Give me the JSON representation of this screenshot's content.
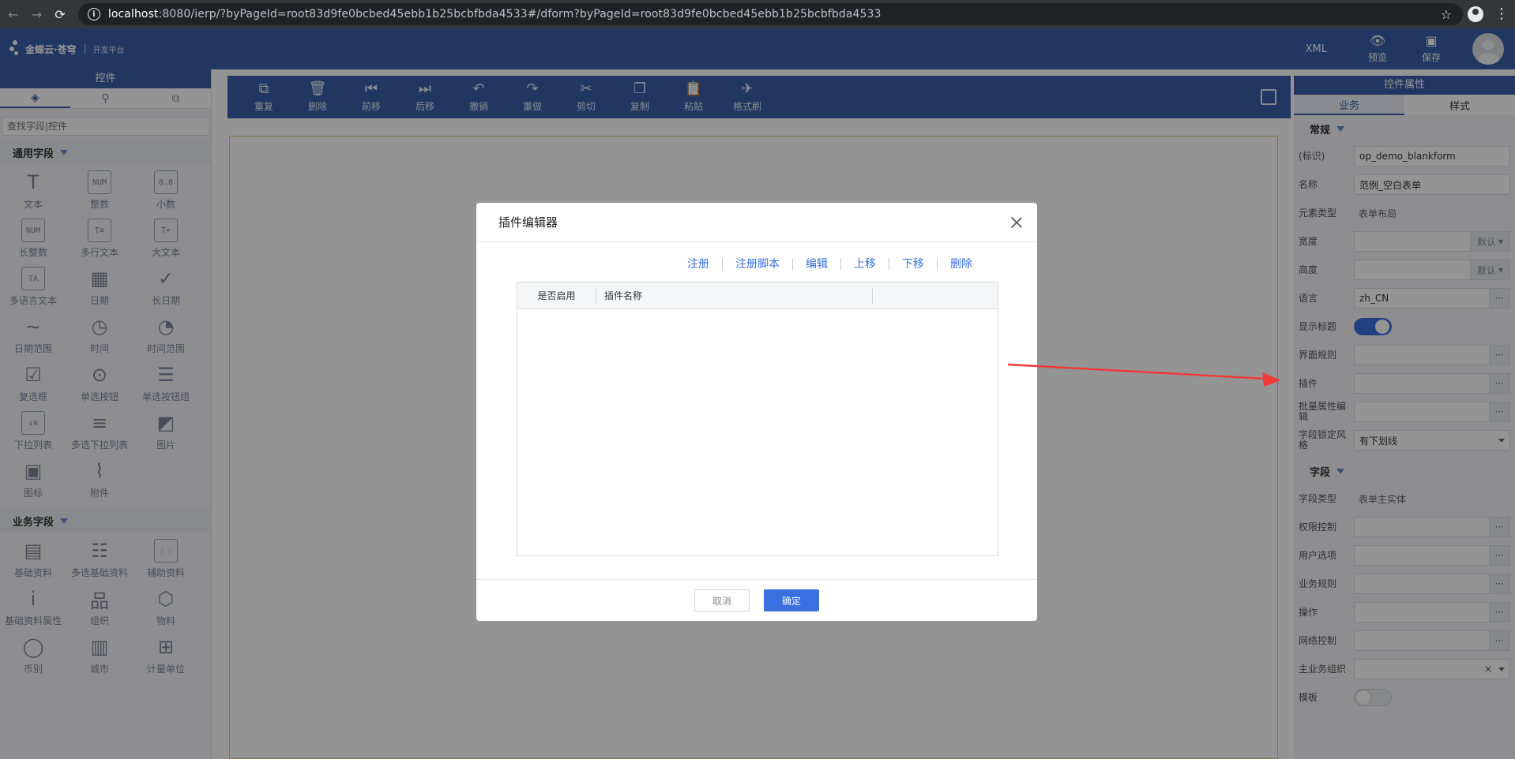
{
  "browser": {
    "url_host": "localhost",
    "url_rest": ":8080/ierp/?byPageId=root83d9fe0bcbed45ebb1b25bcbfbda4533#/dform?byPageId=root83d9fe0bcbed45ebb1b25bcbfbda4533"
  },
  "header": {
    "logo_text": "金蝶云·苍穹",
    "logo_sub": "开发平台",
    "xml": "XML",
    "preview": "预览",
    "save": "保存"
  },
  "left_panel": {
    "title": "控件",
    "search_placeholder": "查找字段|控件",
    "general_section": "通用字段",
    "general_items": [
      {
        "label": "文本",
        "glyph": "T"
      },
      {
        "label": "整数",
        "glyph": "NUM"
      },
      {
        "label": "小数",
        "glyph": "0.0"
      },
      {
        "label": "长整数",
        "glyph": "NUM"
      },
      {
        "label": "多行文本",
        "glyph": "T≡"
      },
      {
        "label": "大文本",
        "glyph": "T+"
      },
      {
        "label": "多语言文本",
        "glyph": "TA"
      },
      {
        "label": "日期",
        "glyph": "▦"
      },
      {
        "label": "长日期",
        "glyph": "✓"
      },
      {
        "label": "日期范围",
        "glyph": "∼"
      },
      {
        "label": "时间",
        "glyph": "◷"
      },
      {
        "label": "时间范围",
        "glyph": "◔"
      },
      {
        "label": "复选框",
        "glyph": "☑"
      },
      {
        "label": "单选按钮",
        "glyph": "⊙"
      },
      {
        "label": "单选按钮组",
        "glyph": "☰"
      },
      {
        "label": "下拉列表",
        "glyph": "↓≡"
      },
      {
        "label": "多选下拉列表",
        "glyph": "≡"
      },
      {
        "label": "图片",
        "glyph": "◩"
      },
      {
        "label": "图标",
        "glyph": "▣"
      },
      {
        "label": "附件",
        "glyph": "⌇"
      }
    ],
    "business_section": "业务字段",
    "business_items": [
      {
        "label": "基础资料",
        "glyph": "▤"
      },
      {
        "label": "多选基础资料",
        "glyph": "☷"
      },
      {
        "label": "辅助资料",
        "glyph": "⋮⋮"
      },
      {
        "label": "基础资料属性",
        "glyph": "i"
      },
      {
        "label": "组织",
        "glyph": "品"
      },
      {
        "label": "物料",
        "glyph": "⬡"
      },
      {
        "label": "币别",
        "glyph": "◯"
      },
      {
        "label": "城市",
        "glyph": "▥"
      },
      {
        "label": "计量单位",
        "glyph": "⊞"
      }
    ]
  },
  "toolbar": {
    "items": [
      {
        "label": "重复",
        "icon": "⧉"
      },
      {
        "label": "删除",
        "icon": "🗑"
      },
      {
        "label": "前移",
        "icon": "⏮"
      },
      {
        "label": "后移",
        "icon": "⏭"
      },
      {
        "label": "撤销",
        "icon": "↶"
      },
      {
        "label": "重做",
        "icon": "↷"
      },
      {
        "label": "剪切",
        "icon": "✂"
      },
      {
        "label": "复制",
        "icon": "❐"
      },
      {
        "label": "粘贴",
        "icon": "📋"
      },
      {
        "label": "格式刷",
        "icon": "✈"
      }
    ]
  },
  "right_panel": {
    "title": "控件属性",
    "tab_business": "业务",
    "tab_style": "样式",
    "section_general": "常规",
    "id_label": "(标识)",
    "id_value": "op_demo_blankform",
    "name_label": "名称",
    "name_value": "范例_空白表单",
    "element_type_label": "元素类型",
    "element_type_value": "表单布局",
    "width_label": "宽度",
    "height_label": "高度",
    "default_text": "默认",
    "language_label": "语言",
    "language_value": "zh_CN",
    "show_title_label": "显示标题",
    "ui_rules_label": "界面规则",
    "plugins_label": "插件",
    "batch_edit_label": "批量属性编辑",
    "field_lock_label": "字段锁定风格",
    "field_lock_value": "有下划线",
    "section_field": "字段",
    "field_type_label": "字段类型",
    "field_type_value": "表单主实体",
    "permission_label": "权限控制",
    "user_options_label": "用户选项",
    "biz_rules_label": "业务规则",
    "operation_label": "操作",
    "network_label": "网络控制",
    "main_org_label": "主业务组织",
    "template_label": "模板",
    "dots": "···",
    "clear": "×"
  },
  "dialog": {
    "title": "插件编辑器",
    "links": [
      "注册",
      "注册脚本",
      "编辑",
      "上移",
      "下移",
      "删除"
    ],
    "col_enabled": "是否启用",
    "col_name": "插件名称",
    "cancel": "取消",
    "ok": "确定"
  },
  "colors": {
    "brand": "#3a5fa8",
    "accent": "#3a6fe0",
    "arrow": "#f03a3a"
  }
}
